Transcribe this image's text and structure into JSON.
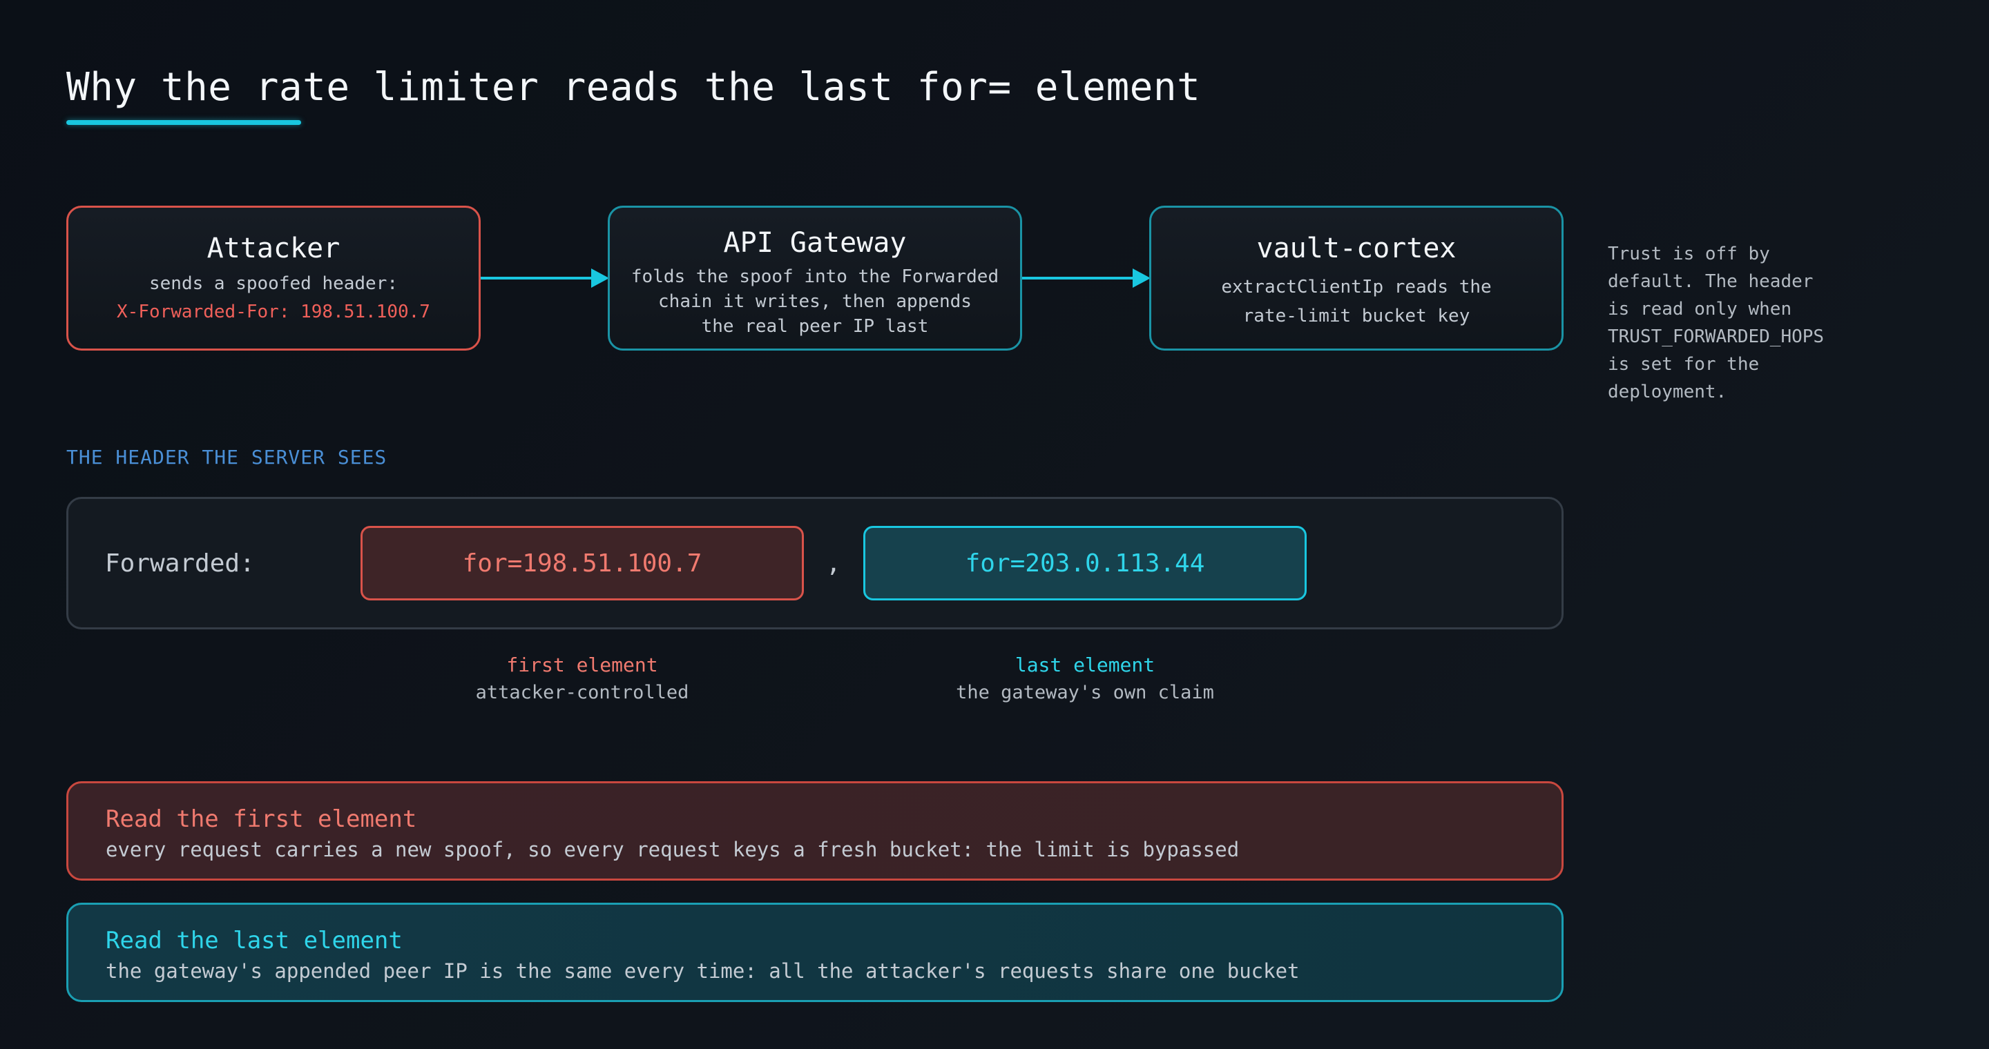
{
  "title": "Why the rate limiter reads the last for= element",
  "flow": {
    "nodes": [
      {
        "title": "Attacker",
        "lines": [
          "sends a spoofed header:"
        ],
        "highlight": "X-Forwarded-For: 198.51.100.7"
      },
      {
        "title": "API Gateway",
        "lines": [
          "folds the spoof into the Forwarded",
          "chain it writes, then appends",
          "the real peer IP last"
        ]
      },
      {
        "title": "vault-cortex",
        "lines": [
          "extractClientIp reads the",
          "rate-limit bucket key"
        ]
      }
    ]
  },
  "side_note": {
    "lines": [
      "Trust is off by",
      "default. The header",
      "is read only when",
      "TRUST_FORWARDED_HOPS",
      "is set for the",
      "deployment."
    ]
  },
  "header_section": {
    "label": "THE HEADER THE SERVER SEES",
    "header_name": "Forwarded:",
    "separator": ",",
    "first_element": {
      "value": "for=198.51.100.7",
      "caption": "first element",
      "note": "attacker-controlled"
    },
    "last_element": {
      "value": "for=203.0.113.44",
      "caption": "last element",
      "note": "the gateway's own claim"
    }
  },
  "outcomes": {
    "first": {
      "title": "Read the first element",
      "body": "every request carries a new spoof, so every request keys a fresh bucket: the limit is bypassed"
    },
    "last": {
      "title": "Read the last element",
      "body": "the gateway's appended peer IP is the same every time: all the attacker's requests share one bucket"
    }
  },
  "colors": {
    "accent_cyan": "#19c7e0",
    "danger_red": "#d9534a",
    "section_blue": "#4a8fd6",
    "background": "#0b1017"
  }
}
